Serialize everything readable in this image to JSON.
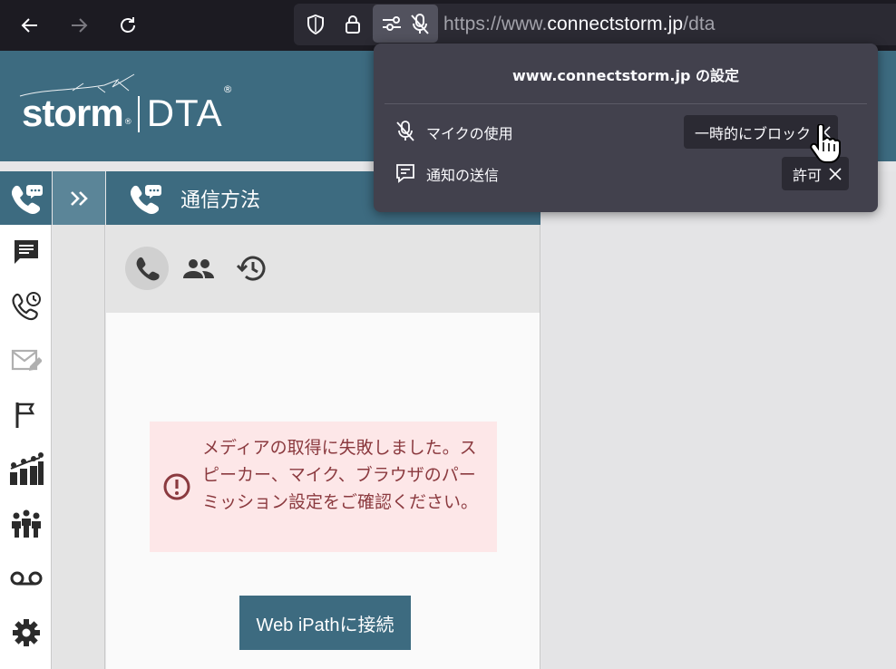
{
  "browser": {
    "url_prefix": "https://www.",
    "url_host": "connectstorm.jp",
    "url_path": "/dta",
    "icons": [
      "back-arrow-icon",
      "forward-arrow-icon",
      "reload-icon",
      "shield-icon",
      "lock-icon",
      "permissions-icon",
      "mic-blocked-icon"
    ]
  },
  "popup": {
    "title": "www.connectstorm.jp の設定",
    "permissions": [
      {
        "label": "マイクの使用",
        "state": "一時的にブロック",
        "icon": "mic-blocked-icon"
      },
      {
        "label": "通知の送信",
        "state": "許可",
        "icon": "notification-icon"
      }
    ]
  },
  "app": {
    "logo_storm": "storm",
    "logo_reg": "®",
    "logo_dta": "DTA",
    "logo_dta_reg": "®",
    "colors": {
      "primary": "#3d6b80",
      "error_bg": "#fde7e8",
      "error_text": "#8b3a3f"
    },
    "rail_icons": [
      "phone-chat-icon",
      "message-icon",
      "phone-history-icon",
      "mail-edit-icon",
      "flag-icon",
      "team-chart-icon",
      "group-icon",
      "voicemail-icon",
      "settings-gear-icon"
    ],
    "expand_icon": "double-chevron-right-icon"
  },
  "panel": {
    "title": "通信方法",
    "tabs": [
      "phone-icon",
      "people-icon",
      "history-icon"
    ],
    "error_message": "メディアの取得に失敗しました。スピーカー、マイク、ブラウザのパーミッション設定をご確認ください。",
    "connect_button": "Web iPathに接続"
  }
}
